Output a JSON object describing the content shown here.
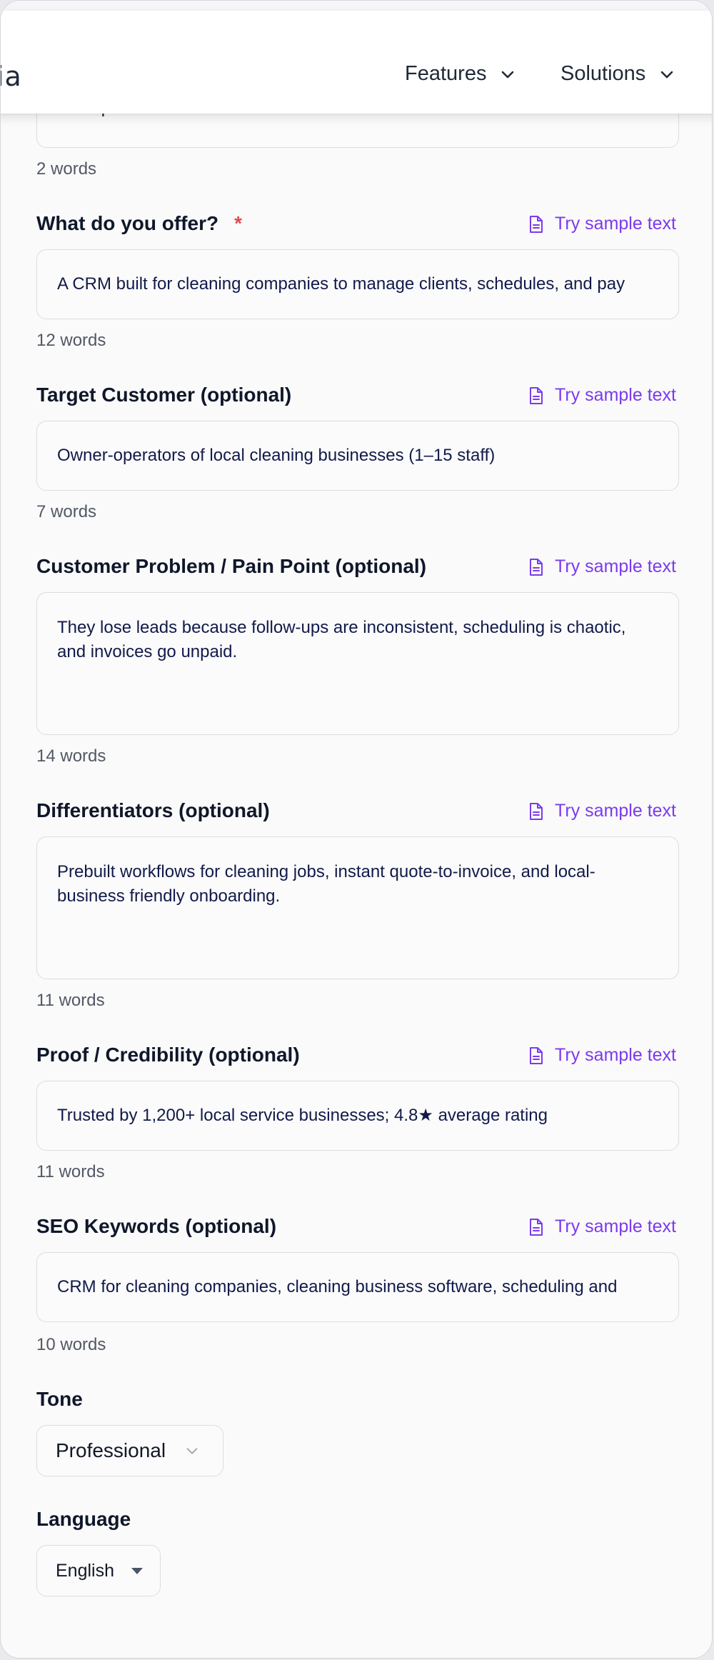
{
  "nav": {
    "brand_fragment": "ia",
    "items": [
      {
        "label": "Features"
      },
      {
        "label": "Solutions"
      }
    ]
  },
  "form": {
    "product_name": {
      "value": "TrailSpark CRM",
      "word_count": "2 words"
    },
    "offer": {
      "label": "What do you offer?",
      "required_mark": "*",
      "sample": "Try sample text",
      "value": "A CRM built for cleaning companies to manage clients, schedules, and pay",
      "word_count": "12 words"
    },
    "target": {
      "label": "Target Customer (optional)",
      "sample": "Try sample text",
      "value": "Owner-operators of local cleaning businesses (1–15 staff)",
      "word_count": "7 words"
    },
    "problem": {
      "label": "Customer Problem / Pain Point (optional)",
      "sample": "Try sample text",
      "value": "They lose leads because follow-ups are inconsistent, scheduling is chaotic, and invoices go unpaid.",
      "word_count": "14 words"
    },
    "differentiators": {
      "label": "Differentiators (optional)",
      "sample": "Try sample text",
      "value": "Prebuilt workflows for cleaning jobs, instant quote-to-invoice, and local-business friendly onboarding.",
      "word_count": "11 words"
    },
    "proof": {
      "label": "Proof / Credibility (optional)",
      "sample": "Try sample text",
      "value": "Trusted by 1,200+ local service businesses; 4.8★ average rating",
      "word_count": "11 words"
    },
    "seo": {
      "label": "SEO Keywords (optional)",
      "sample": "Try sample text",
      "value": "CRM for cleaning companies, cleaning business software, scheduling and",
      "word_count": "10 words"
    },
    "tone": {
      "label": "Tone",
      "selected": "Professional"
    },
    "language": {
      "label": "Language",
      "selected": "English"
    }
  },
  "colors": {
    "accent": "#7c3aed",
    "required": "#e5484d",
    "text": "#111a4a"
  }
}
